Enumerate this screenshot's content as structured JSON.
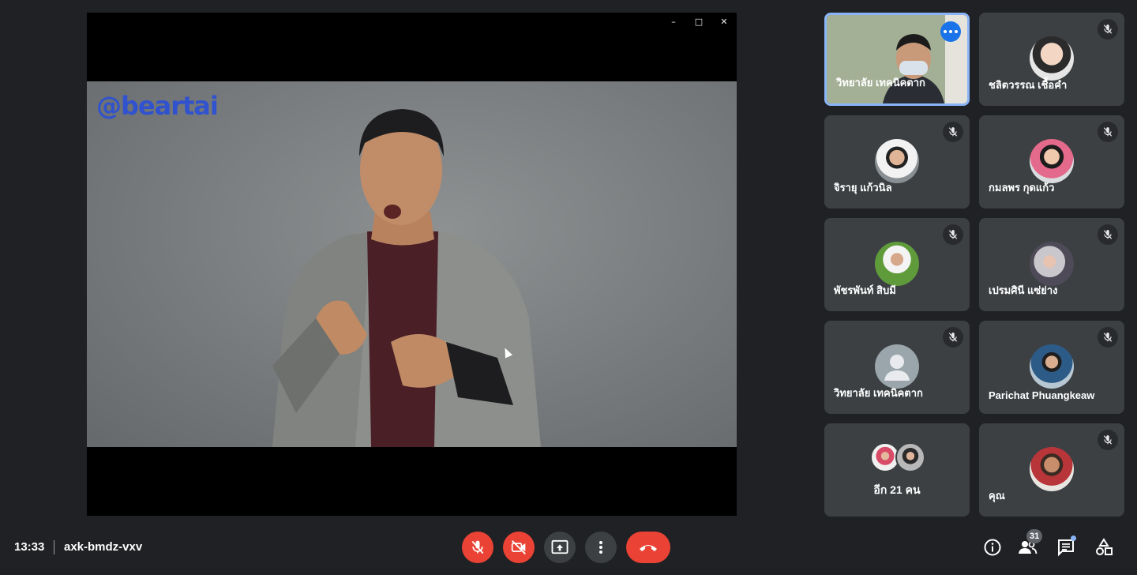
{
  "presentation": {
    "watermark": "@beartai",
    "window_controls": {
      "minimize": "–",
      "maximize": "□",
      "close": "✕"
    }
  },
  "participants": [
    {
      "name": "วิทยาลัย เทคนิคตาก",
      "muted": false,
      "video": true,
      "active": true
    },
    {
      "name": "ชลิตวรรณ เชื้อคำ",
      "muted": true
    },
    {
      "name": "จิรายุ แก้วนิล",
      "muted": true
    },
    {
      "name": "กมลพร กุดแก้ว",
      "muted": true
    },
    {
      "name": "พัชรพันท์ สิบมี",
      "muted": true
    },
    {
      "name": "เปรมศินี แซ่ย่าง",
      "muted": true
    },
    {
      "name": "วิทยาลัย เทคนิคตาก",
      "muted": true
    },
    {
      "name": "Parichat Phuangkeaw",
      "muted": true
    },
    {
      "name": "อีก 21 คน",
      "muted": false
    },
    {
      "name": "คุณ",
      "muted": true
    }
  ],
  "bottombar": {
    "time": "13:33",
    "meeting_code": "axk-bmdz-vxv",
    "people_count": "31"
  },
  "colors": {
    "background": "#202124",
    "tile": "#3c4043",
    "danger": "#ea4335",
    "accent": "#8ab4f8"
  }
}
